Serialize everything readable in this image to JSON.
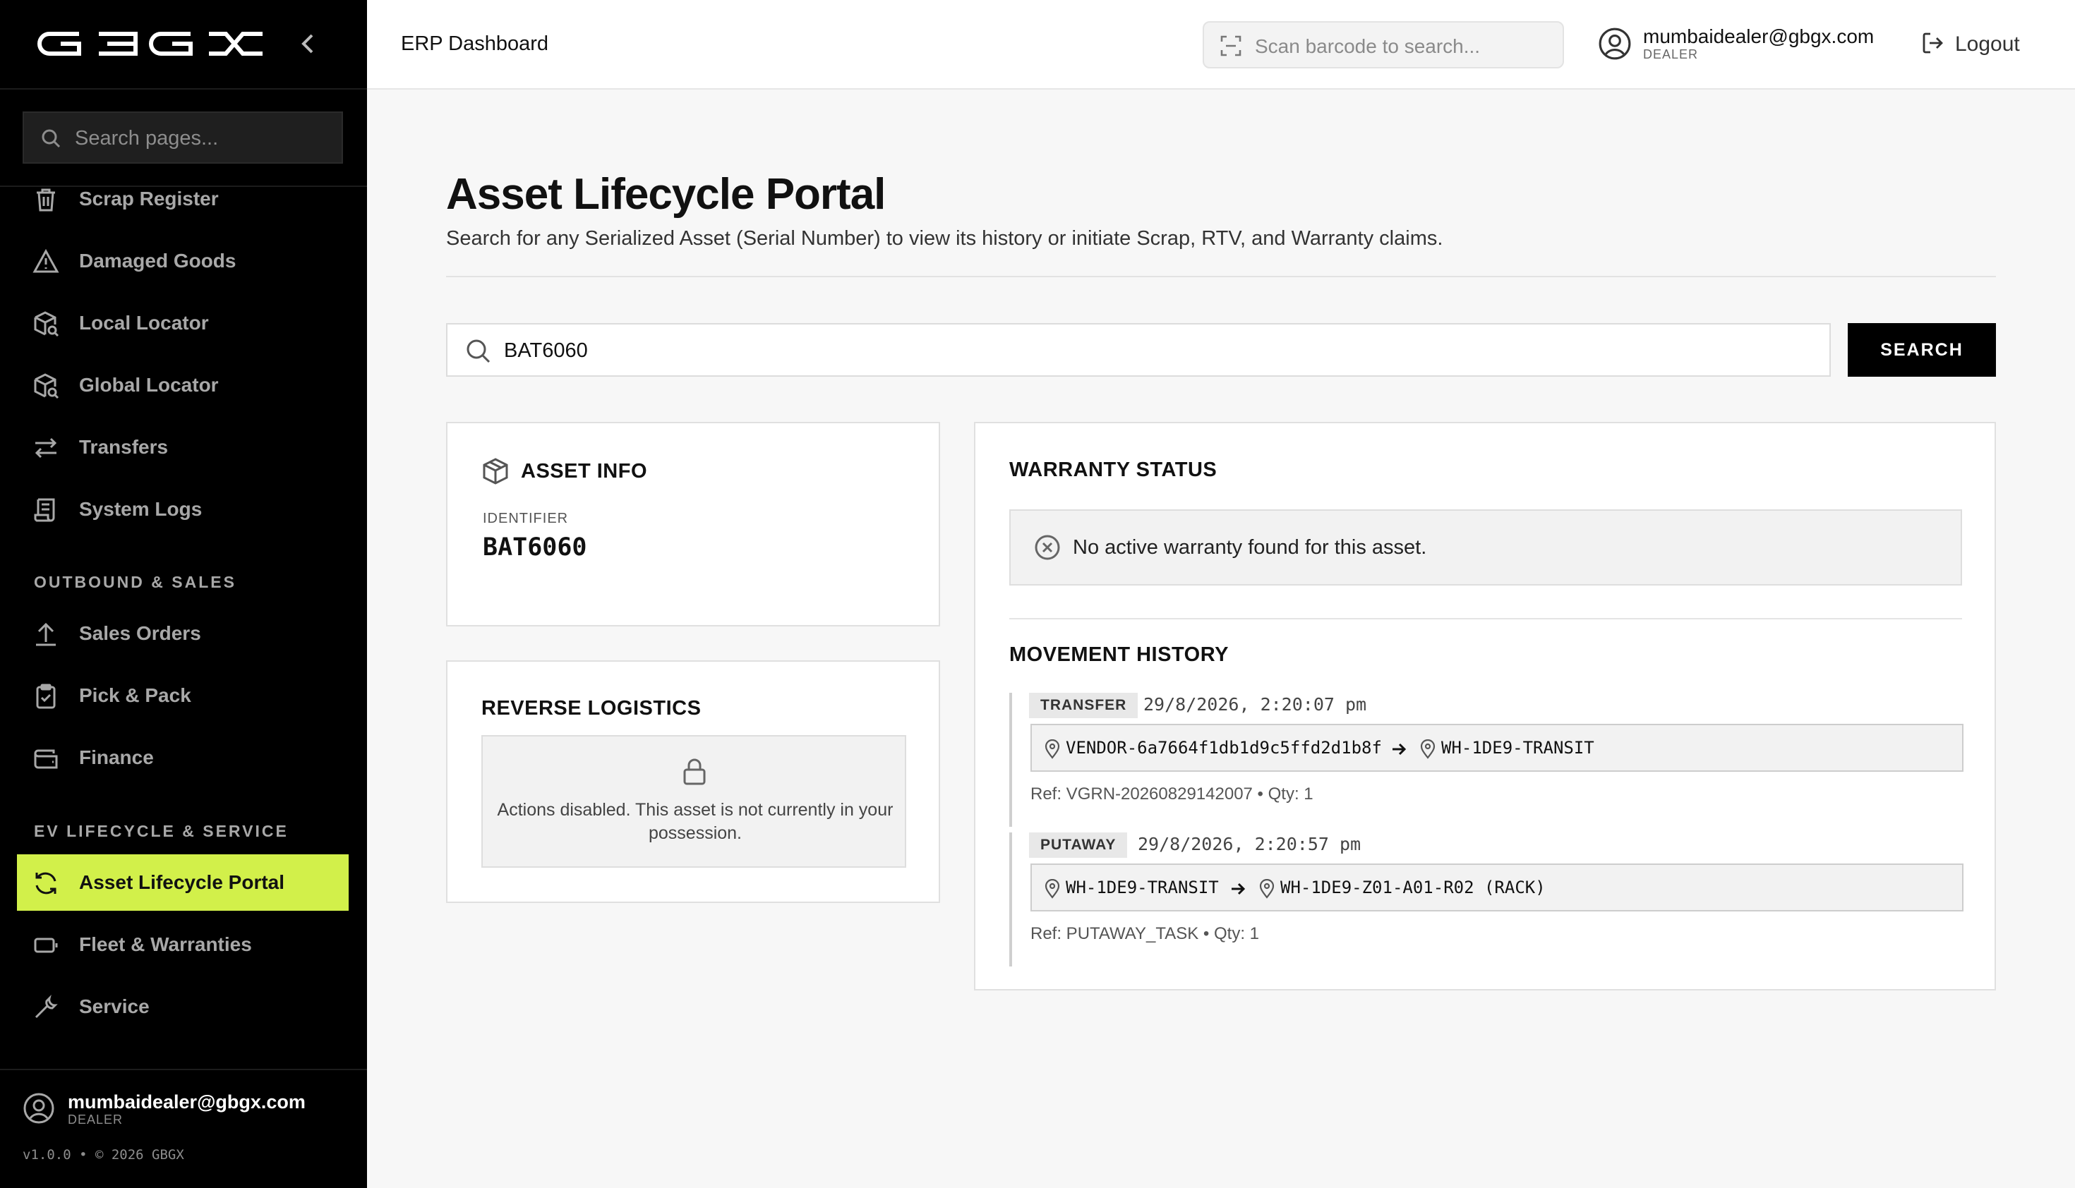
{
  "app": {
    "logo_text": "GBGX",
    "header_title": "ERP Dashboard"
  },
  "sidebar": {
    "search_placeholder": "Search pages...",
    "items_top": [
      {
        "label": "Scrap Register",
        "icon": "trash-icon"
      },
      {
        "label": "Damaged Goods",
        "icon": "warning-triangle-icon"
      },
      {
        "label": "Local Locator",
        "icon": "package-search-icon"
      },
      {
        "label": "Global Locator",
        "icon": "package-search-icon"
      },
      {
        "label": "Transfers",
        "icon": "arrows-left-right-icon"
      },
      {
        "label": "System Logs",
        "icon": "scroll-text-icon"
      }
    ],
    "section_outbound": "OUTBOUND & SALES",
    "items_outbound": [
      {
        "label": "Sales Orders",
        "icon": "upload-icon"
      },
      {
        "label": "Pick & Pack",
        "icon": "clipboard-check-icon"
      },
      {
        "label": "Finance",
        "icon": "wallet-icon"
      }
    ],
    "section_ev": "EV LIFECYCLE & SERVICE",
    "items_ev": [
      {
        "label": "Asset Lifecycle Portal",
        "icon": "refresh-icon",
        "active": true
      },
      {
        "label": "Fleet & Warranties",
        "icon": "battery-icon"
      },
      {
        "label": "Service",
        "icon": "wrench-icon"
      }
    ],
    "user": {
      "email": "mumbaidealer@gbgx.com",
      "role": "DEALER"
    },
    "version": "v1.0.0 • © 2026 GBGX"
  },
  "topbar": {
    "barcode_placeholder": "Scan barcode to search...",
    "user_email": "mumbaidealer@gbgx.com",
    "user_role": "DEALER",
    "logout_label": "Logout"
  },
  "page": {
    "title": "Asset Lifecycle Portal",
    "subtitle": "Search for any Serialized Asset (Serial Number) to view its history or initiate Scrap, RTV, and Warranty claims.",
    "search_value": "BAT6060",
    "search_button": "SEARCH"
  },
  "asset_info": {
    "title": "ASSET INFO",
    "identifier_label": "IDENTIFIER",
    "identifier_value": "BAT6060"
  },
  "reverse_logistics": {
    "title": "REVERSE LOGISTICS",
    "message": "Actions disabled. This asset is not currently in your possession."
  },
  "warranty": {
    "title": "WARRANTY STATUS",
    "message": "No active warranty found for this asset."
  },
  "movement_history": {
    "title": "MOVEMENT HISTORY",
    "entries": [
      {
        "type": "TRANSFER",
        "timestamp": "29/8/2026, 2:20:07 pm",
        "from": "VENDOR-6a7664f1db1d9c5ffd2d1b8f",
        "to": "WH-1DE9-TRANSIT",
        "ref": "Ref: VGRN-20260829142007 • Qty: 1"
      },
      {
        "type": "PUTAWAY",
        "timestamp": "29/8/2026, 2:20:57 pm",
        "from": "WH-1DE9-TRANSIT",
        "to": "WH-1DE9-Z01-A01-R02 (RACK)",
        "ref": "Ref: PUTAWAY_TASK • Qty: 1"
      }
    ]
  },
  "colors": {
    "sidebar_bg": "#000000",
    "accent": "#d2f04a",
    "page_bg": "#f7f7f7"
  }
}
